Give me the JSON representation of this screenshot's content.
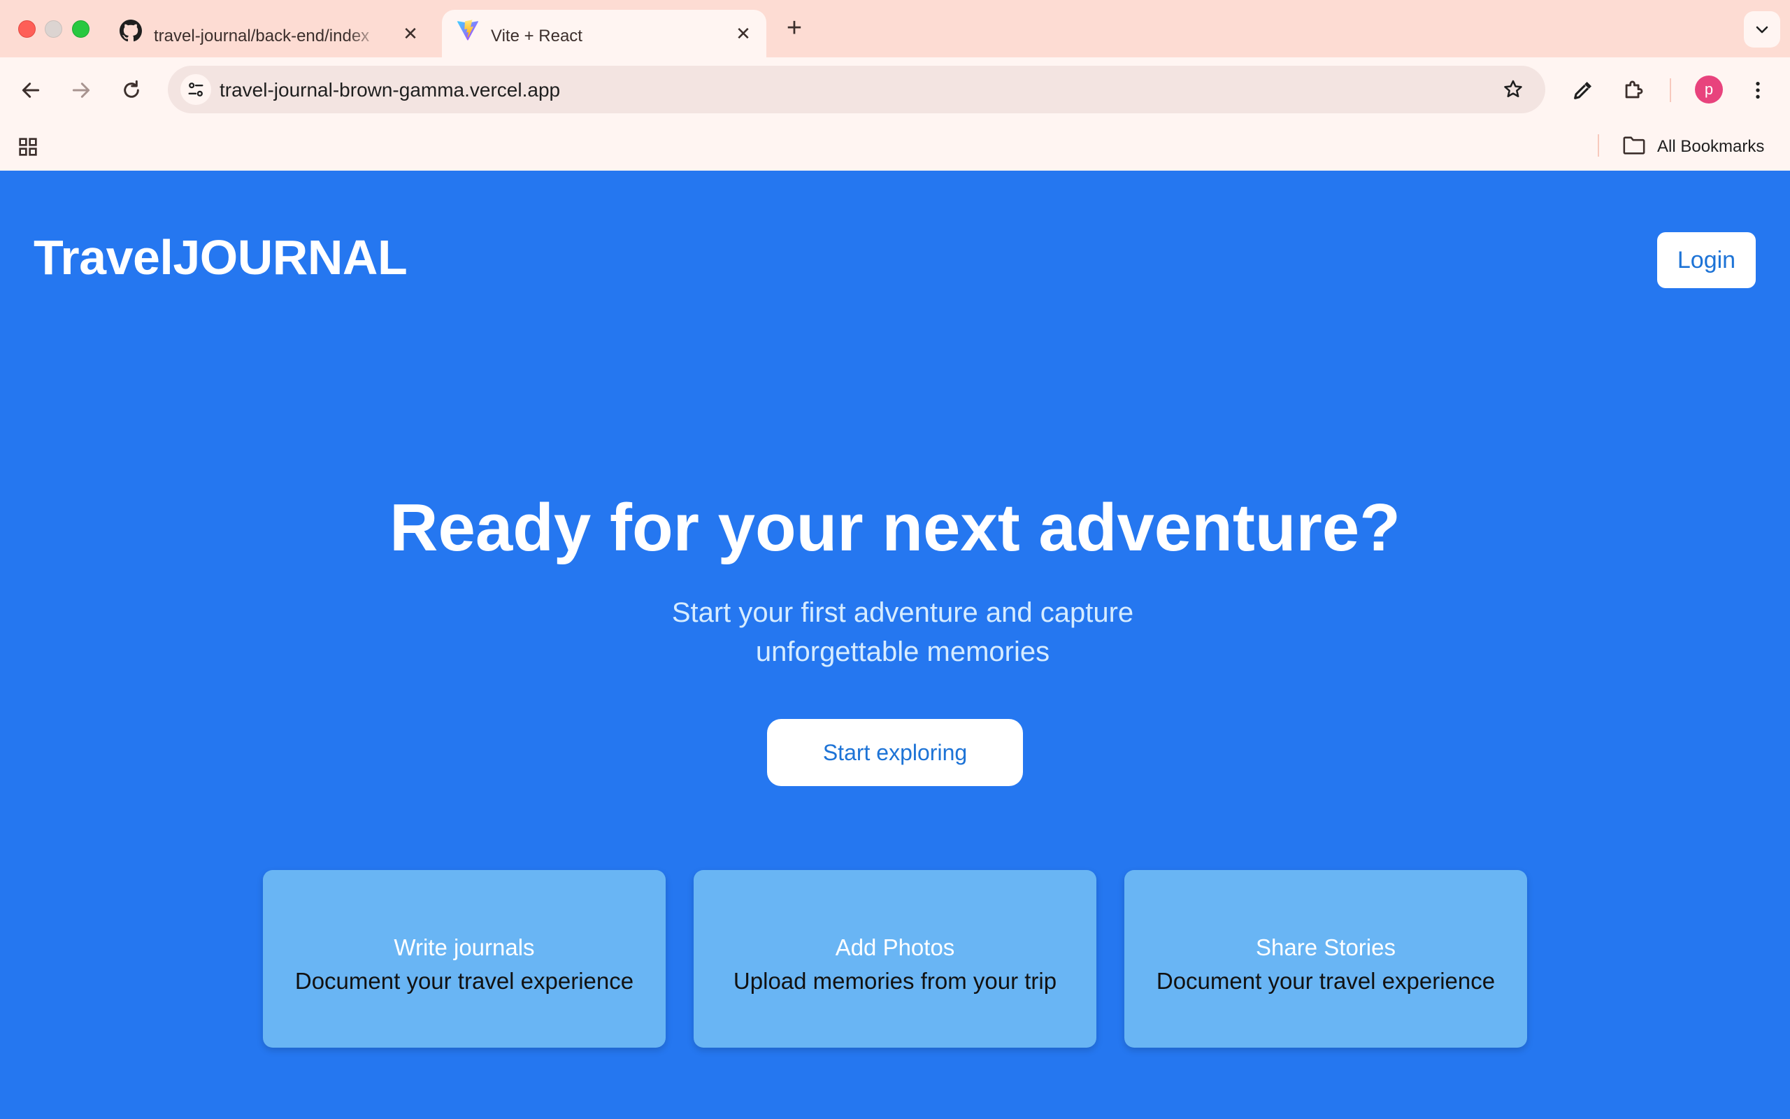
{
  "browser": {
    "tabs": [
      {
        "title": "travel-journal/back-end/index",
        "favicon": "github-icon",
        "active": false
      },
      {
        "title": "Vite + React",
        "favicon": "vite-icon",
        "active": true
      }
    ],
    "url": "travel-journal-brown-gamma.vercel.app",
    "profile_initial": "p",
    "bookmarks_label": "All Bookmarks"
  },
  "header": {
    "brand": "TravelJOURNAL",
    "login_label": "Login"
  },
  "hero": {
    "title": "Ready for your next adventure?",
    "subtitle_line1": "Start your first adventure and capture",
    "subtitle_line2": "unforgettable memories",
    "cta_label": "Start exploring"
  },
  "features": [
    {
      "title": "Write journals",
      "description": "Document your travel experience"
    },
    {
      "title": "Add Photos",
      "description": "Upload memories from your trip"
    },
    {
      "title": "Share Stories",
      "description": "Document your travel experience"
    }
  ],
  "colors": {
    "page_background": "#2577f0",
    "card_background": "#69b5f4",
    "button_text": "#1d73d6",
    "tabstrip": "#fddcd3"
  }
}
